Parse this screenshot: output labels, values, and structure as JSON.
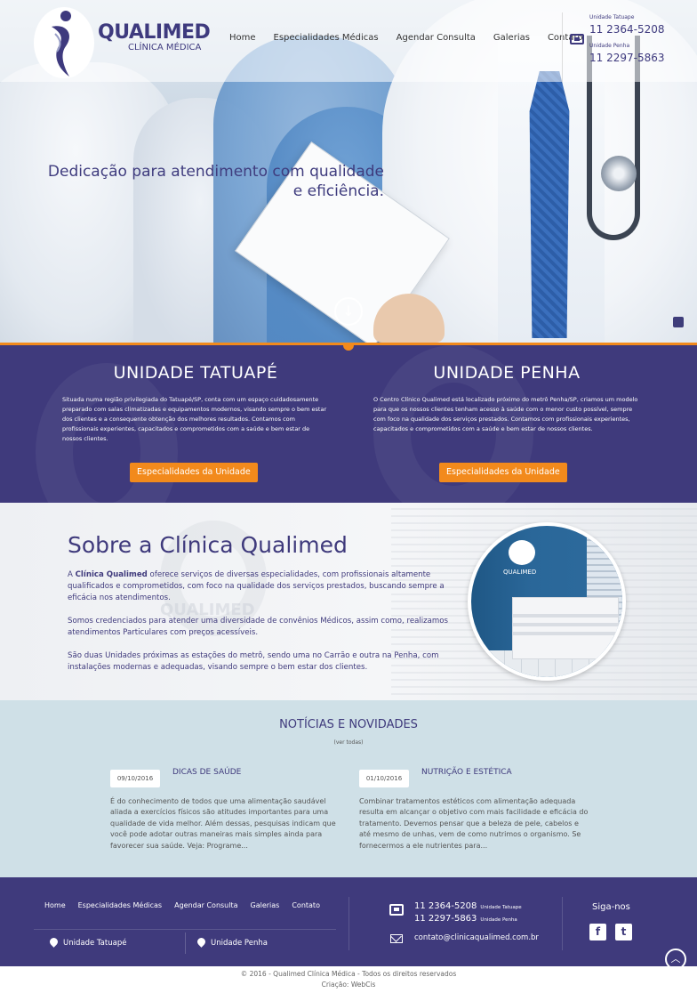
{
  "header": {
    "brand": "QUALIMED",
    "brand_sub": "CLÍNICA MÉDICA",
    "nav": [
      "Home",
      "Especialidades Médicas",
      "Agendar Consulta",
      "Galerias",
      "Contato"
    ],
    "phone_unit_1": "Unidade Tatuape",
    "phone_1": "11 2364-5208",
    "phone_unit_2": "Unidade Penha",
    "phone_2": "11 2297-5863"
  },
  "hero": {
    "tagline": "Dedicação para atendimento com qualidade e eficiência.",
    "scroll_icon": "arrow-down-circle"
  },
  "units": {
    "tatuape": {
      "title": "UNIDADE TATUAPÉ",
      "text": "Situada numa  região privilegiada do Tatuapé/SP, conta com um espaço cuidadosamente preparado com  salas climatizadas e equipamentos modernos, visando sempre o bem estar dos clientes e a consequente  obtenção dos melhores resultados.  Contamos com profissionais experientes, capacitados e comprometidos com a saúde e bem estar de nossos clientes.",
      "button": "Especialidades da Unidade"
    },
    "penha": {
      "title": "UNIDADE PENHA",
      "text": "O Centro Clínico Qualimed está localizado próximo do metrô Penha/SP, criamos um modelo para que os nossos clientes tenham acesso à saúde com o menor custo possível, sempre com foco na qualidade dos serviços prestados. Contamos com profissionais experientes, capacitados e comprometidos com a saúde e bem estar de nossos clientes.",
      "button": "Especialidades da Unidade"
    }
  },
  "about": {
    "title": "Sobre a Clínica Qualimed",
    "p1_strong": "Clínica Qualimed",
    "p1_pre": "A ",
    "p1_post": "  oferece serviços de diversas especialidades, com  profissionais altamente qualificados e comprometidos, com foco na qualidade dos serviços prestados, buscando sempre a eficácia nos atendimentos.",
    "p2": "Somos credenciados para atender uma diversidade de convênios Médicos, assim como, realizamos atendimentos Particulares com preços acessíveis.",
    "p3": "São duas Unidades próximas as estações do metrô, sendo uma no Carrão e outra na Penha, com instalações modernas e adequadas, visando sempre o bem estar dos clientes.",
    "watermark": "QUALIMED",
    "photo_sign": "QUALIMED"
  },
  "news": {
    "title": "NOTÍCIAS E NOVIDADES",
    "see_all": "(ver todas)",
    "items": [
      {
        "date": "09/10/2016",
        "category": "DICAS DE SAÚDE",
        "text": "É do conhecimento de todos que uma alimentação saudável aliada a exercícios físicos são atitudes importantes para uma qualidade de vida melhor. Além dessas, pesquisas indicam que você pode adotar outras maneiras mais simples ainda para favorecer sua saúde. Veja: Programe..."
      },
      {
        "date": "01/10/2016",
        "category": "NUTRIÇÃO E ESTÉTICA",
        "text": "Combinar tratamentos estéticos com alimentação adequada resulta em alcançar o objetivo com mais facilidade e eficácia do tratamento. Devemos pensar que a beleza de pele, cabelos e até mesmo de unhas, vem de como nutrimos o organismo. Se fornecermos a ele nutrientes para..."
      }
    ]
  },
  "footer": {
    "nav": [
      "Home",
      "Especialidades Médicas",
      "Agendar Consulta",
      "Galerias",
      "Contato"
    ],
    "loc_1": "Unidade Tatuapé",
    "loc_2": "Unidade Penha",
    "phone_1": "11 2364-5208",
    "phone_1_label": "Unidade Tatuape",
    "phone_2": "11 2297-5863",
    "phone_2_label": "Unidade Penha",
    "email": "contato@clinicaqualimed.com.br",
    "social_title": "Siga-nos",
    "facebook": "f",
    "twitter": "t",
    "copyright": "© 2016 - Qualimed Clínica Médica - Todos os direitos reservados",
    "credit": "Criação: WebCis"
  },
  "colors": {
    "primary": "#3f3a7c",
    "accent": "#f28a1c",
    "news_bg": "#cfe0e7"
  }
}
